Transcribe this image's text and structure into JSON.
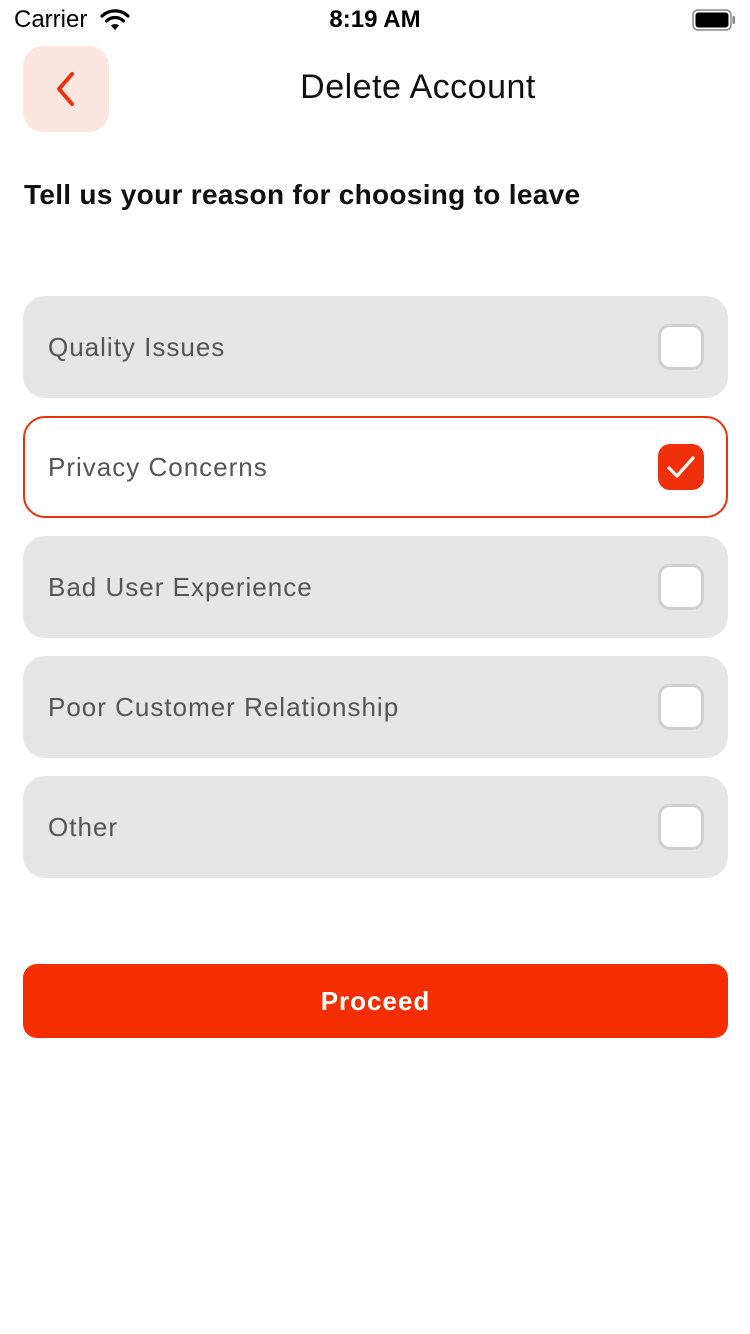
{
  "status_bar": {
    "carrier": "Carrier",
    "time": "8:19 AM"
  },
  "header": {
    "back_icon": "chevron-left-icon",
    "title": "Delete Account"
  },
  "question": "Tell us your reason for choosing to leave",
  "options": [
    {
      "label": "Quality Issues",
      "checked": false
    },
    {
      "label": "Privacy Concerns",
      "checked": true
    },
    {
      "label": "Bad User Experience",
      "checked": false
    },
    {
      "label": "Poor Customer Relationship",
      "checked": false
    },
    {
      "label": "Other",
      "checked": false
    }
  ],
  "proceed_label": "Proceed",
  "colors": {
    "accent": "#f52e02",
    "back_button_bg": "#fde6e0",
    "option_bg": "#e6e6e6",
    "checkbox_border": "#cfcfcf"
  }
}
